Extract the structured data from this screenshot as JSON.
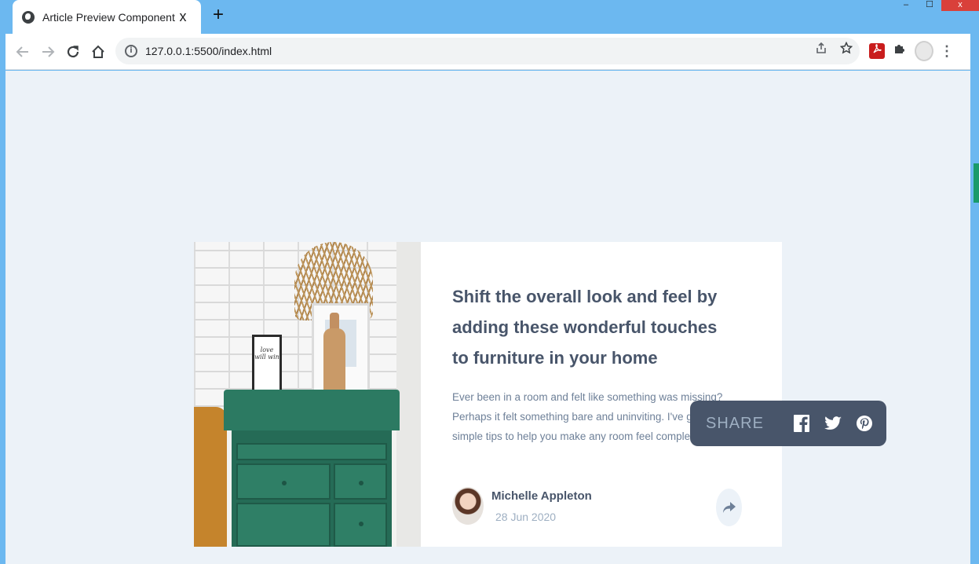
{
  "browser": {
    "tab_title": "Article Preview Component",
    "tab_close": "x",
    "new_tab": "+",
    "url": "127.0.0.1:5500/index.html",
    "info_symbol": "i",
    "minimize": "–",
    "maximize": "☐",
    "close": "x",
    "menu": "⋮"
  },
  "article": {
    "title": "Shift the overall look and feel by adding these wonderful touches to furniture in your home",
    "description": "Ever been in a room and felt like something was missing? Perhaps it felt something bare and uninviting. I've got some simple tips to help you make any room feel complete.",
    "frame_text": "love will win"
  },
  "author": {
    "name": "Michelle Appleton",
    "date": "28 Jun 2020"
  },
  "share": {
    "label": "SHARE",
    "icons": [
      "facebook-icon",
      "twitter-icon",
      "pinterest-icon"
    ]
  },
  "colors": {
    "page_bg": "#ecf2f8",
    "dark_text": "#48556a",
    "muted_text": "#9eafc2",
    "share_bg": "#48556a"
  }
}
